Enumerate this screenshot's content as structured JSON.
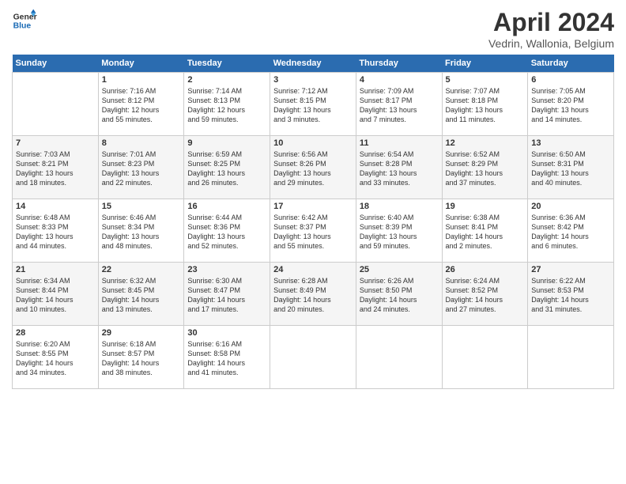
{
  "header": {
    "logo_general": "General",
    "logo_blue": "Blue",
    "title": "April 2024",
    "location": "Vedrin, Wallonia, Belgium"
  },
  "calendar": {
    "days_of_week": [
      "Sunday",
      "Monday",
      "Tuesday",
      "Wednesday",
      "Thursday",
      "Friday",
      "Saturday"
    ],
    "weeks": [
      [
        {
          "day": "",
          "info": ""
        },
        {
          "day": "1",
          "info": "Sunrise: 7:16 AM\nSunset: 8:12 PM\nDaylight: 12 hours\nand 55 minutes."
        },
        {
          "day": "2",
          "info": "Sunrise: 7:14 AM\nSunset: 8:13 PM\nDaylight: 12 hours\nand 59 minutes."
        },
        {
          "day": "3",
          "info": "Sunrise: 7:12 AM\nSunset: 8:15 PM\nDaylight: 13 hours\nand 3 minutes."
        },
        {
          "day": "4",
          "info": "Sunrise: 7:09 AM\nSunset: 8:17 PM\nDaylight: 13 hours\nand 7 minutes."
        },
        {
          "day": "5",
          "info": "Sunrise: 7:07 AM\nSunset: 8:18 PM\nDaylight: 13 hours\nand 11 minutes."
        },
        {
          "day": "6",
          "info": "Sunrise: 7:05 AM\nSunset: 8:20 PM\nDaylight: 13 hours\nand 14 minutes."
        }
      ],
      [
        {
          "day": "7",
          "info": "Sunrise: 7:03 AM\nSunset: 8:21 PM\nDaylight: 13 hours\nand 18 minutes."
        },
        {
          "day": "8",
          "info": "Sunrise: 7:01 AM\nSunset: 8:23 PM\nDaylight: 13 hours\nand 22 minutes."
        },
        {
          "day": "9",
          "info": "Sunrise: 6:59 AM\nSunset: 8:25 PM\nDaylight: 13 hours\nand 26 minutes."
        },
        {
          "day": "10",
          "info": "Sunrise: 6:56 AM\nSunset: 8:26 PM\nDaylight: 13 hours\nand 29 minutes."
        },
        {
          "day": "11",
          "info": "Sunrise: 6:54 AM\nSunset: 8:28 PM\nDaylight: 13 hours\nand 33 minutes."
        },
        {
          "day": "12",
          "info": "Sunrise: 6:52 AM\nSunset: 8:29 PM\nDaylight: 13 hours\nand 37 minutes."
        },
        {
          "day": "13",
          "info": "Sunrise: 6:50 AM\nSunset: 8:31 PM\nDaylight: 13 hours\nand 40 minutes."
        }
      ],
      [
        {
          "day": "14",
          "info": "Sunrise: 6:48 AM\nSunset: 8:33 PM\nDaylight: 13 hours\nand 44 minutes."
        },
        {
          "day": "15",
          "info": "Sunrise: 6:46 AM\nSunset: 8:34 PM\nDaylight: 13 hours\nand 48 minutes."
        },
        {
          "day": "16",
          "info": "Sunrise: 6:44 AM\nSunset: 8:36 PM\nDaylight: 13 hours\nand 52 minutes."
        },
        {
          "day": "17",
          "info": "Sunrise: 6:42 AM\nSunset: 8:37 PM\nDaylight: 13 hours\nand 55 minutes."
        },
        {
          "day": "18",
          "info": "Sunrise: 6:40 AM\nSunset: 8:39 PM\nDaylight: 13 hours\nand 59 minutes."
        },
        {
          "day": "19",
          "info": "Sunrise: 6:38 AM\nSunset: 8:41 PM\nDaylight: 14 hours\nand 2 minutes."
        },
        {
          "day": "20",
          "info": "Sunrise: 6:36 AM\nSunset: 8:42 PM\nDaylight: 14 hours\nand 6 minutes."
        }
      ],
      [
        {
          "day": "21",
          "info": "Sunrise: 6:34 AM\nSunset: 8:44 PM\nDaylight: 14 hours\nand 10 minutes."
        },
        {
          "day": "22",
          "info": "Sunrise: 6:32 AM\nSunset: 8:45 PM\nDaylight: 14 hours\nand 13 minutes."
        },
        {
          "day": "23",
          "info": "Sunrise: 6:30 AM\nSunset: 8:47 PM\nDaylight: 14 hours\nand 17 minutes."
        },
        {
          "day": "24",
          "info": "Sunrise: 6:28 AM\nSunset: 8:49 PM\nDaylight: 14 hours\nand 20 minutes."
        },
        {
          "day": "25",
          "info": "Sunrise: 6:26 AM\nSunset: 8:50 PM\nDaylight: 14 hours\nand 24 minutes."
        },
        {
          "day": "26",
          "info": "Sunrise: 6:24 AM\nSunset: 8:52 PM\nDaylight: 14 hours\nand 27 minutes."
        },
        {
          "day": "27",
          "info": "Sunrise: 6:22 AM\nSunset: 8:53 PM\nDaylight: 14 hours\nand 31 minutes."
        }
      ],
      [
        {
          "day": "28",
          "info": "Sunrise: 6:20 AM\nSunset: 8:55 PM\nDaylight: 14 hours\nand 34 minutes."
        },
        {
          "day": "29",
          "info": "Sunrise: 6:18 AM\nSunset: 8:57 PM\nDaylight: 14 hours\nand 38 minutes."
        },
        {
          "day": "30",
          "info": "Sunrise: 6:16 AM\nSunset: 8:58 PM\nDaylight: 14 hours\nand 41 minutes."
        },
        {
          "day": "",
          "info": ""
        },
        {
          "day": "",
          "info": ""
        },
        {
          "day": "",
          "info": ""
        },
        {
          "day": "",
          "info": ""
        }
      ]
    ]
  }
}
